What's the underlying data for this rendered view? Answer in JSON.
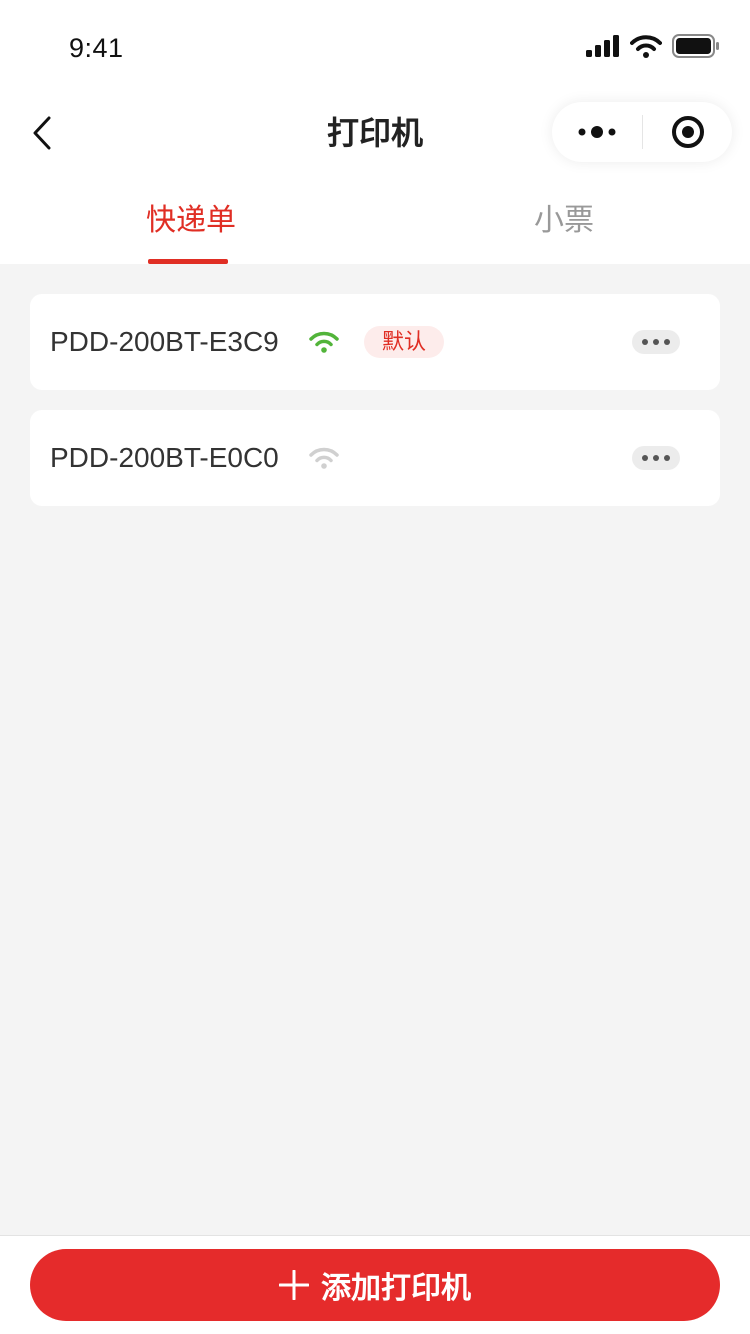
{
  "status_bar": {
    "time": "9:41"
  },
  "nav": {
    "title": "打印机"
  },
  "tabs": [
    {
      "label": "快递单",
      "active": true
    },
    {
      "label": "小票",
      "active": false
    }
  ],
  "printers": [
    {
      "name": "PDD-200BT-E3C9",
      "connected": true,
      "badge": "默认"
    },
    {
      "name": "PDD-200BT-E0C0",
      "connected": false
    }
  ],
  "footer": {
    "add_button_label": "添加打印机"
  },
  "colors": {
    "accent": "#e02e24",
    "connected": "#52b43a",
    "disconnected": "#d0d0d0",
    "badge_bg": "#fdeceb"
  }
}
